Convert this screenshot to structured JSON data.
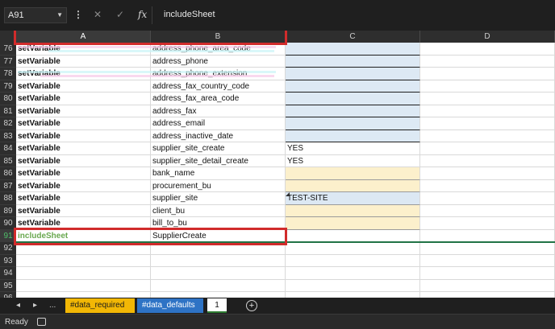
{
  "formula_bar": {
    "name_box": "A91",
    "fx_label": "fx",
    "formula": "includeSheet"
  },
  "columns": [
    "A",
    "B",
    "C",
    "D"
  ],
  "rows": [
    {
      "num": "76",
      "a": "setVariable",
      "b": "address_phone_area_code",
      "c": "",
      "c_fill": "blue"
    },
    {
      "num": "77",
      "a": "setVariable",
      "b": "address_phone",
      "c": "",
      "c_fill": "blue"
    },
    {
      "num": "78",
      "a": "setVariable",
      "b": "address_phone_extension",
      "c": "",
      "c_fill": "blue"
    },
    {
      "num": "79",
      "a": "setVariable",
      "b": "address_fax_country_code",
      "c": "",
      "c_fill": "blue"
    },
    {
      "num": "80",
      "a": "setVariable",
      "b": "address_fax_area_code",
      "c": "",
      "c_fill": "blue"
    },
    {
      "num": "81",
      "a": "setVariable",
      "b": "address_fax",
      "c": "",
      "c_fill": "blue"
    },
    {
      "num": "82",
      "a": "setVariable",
      "b": "address_email",
      "c": "",
      "c_fill": "blue"
    },
    {
      "num": "83",
      "a": "setVariable",
      "b": "address_inactive_date",
      "c": "",
      "c_fill": "blue"
    },
    {
      "num": "84",
      "a": "setVariable",
      "b": "supplier_site_create",
      "c": "YES",
      "c_fill": "none"
    },
    {
      "num": "85",
      "a": "setVariable",
      "b": "supplier_site_detail_create",
      "c": "YES",
      "c_fill": "none"
    },
    {
      "num": "86",
      "a": "setVariable",
      "b": "bank_name",
      "c": "",
      "c_fill": "yellow"
    },
    {
      "num": "87",
      "a": "setVariable",
      "b": "procurement_bu",
      "c": "",
      "c_fill": "yellow"
    },
    {
      "num": "88",
      "a": "setVariable",
      "b": "supplier_site",
      "c": "TEST-SITE",
      "c_fill": "blue2"
    },
    {
      "num": "89",
      "a": "setVariable",
      "b": "client_bu",
      "c": "",
      "c_fill": "yellow"
    },
    {
      "num": "90",
      "a": "setVariable",
      "b": "bill_to_bu",
      "c": "",
      "c_fill": "yellow"
    },
    {
      "num": "91",
      "a": "includeSheet",
      "b": "SupplierCreate",
      "c": "",
      "c_fill": "none"
    },
    {
      "num": "92",
      "a": "",
      "b": "",
      "c": "",
      "c_fill": "none"
    },
    {
      "num": "93",
      "a": "",
      "b": "",
      "c": "",
      "c_fill": "none"
    },
    {
      "num": "94",
      "a": "",
      "b": "",
      "c": "",
      "c_fill": "none"
    },
    {
      "num": "95",
      "a": "",
      "b": "",
      "c": "",
      "c_fill": "none"
    },
    {
      "num": "96",
      "a": "",
      "b": "",
      "c": "",
      "c_fill": "none"
    }
  ],
  "tabs": {
    "prev": "◂",
    "next": "▸",
    "more": "...",
    "items": [
      "#data_required",
      "#data_defaults",
      "1"
    ],
    "add": "+"
  },
  "status": {
    "ready": "Ready"
  },
  "colors": {
    "highlight_box": "#d12b2b",
    "tab_required": "#f2b705",
    "tab_defaults": "#2e73c5",
    "fill_blue": "#dde9f4",
    "fill_yellow": "#fcf0cc"
  }
}
